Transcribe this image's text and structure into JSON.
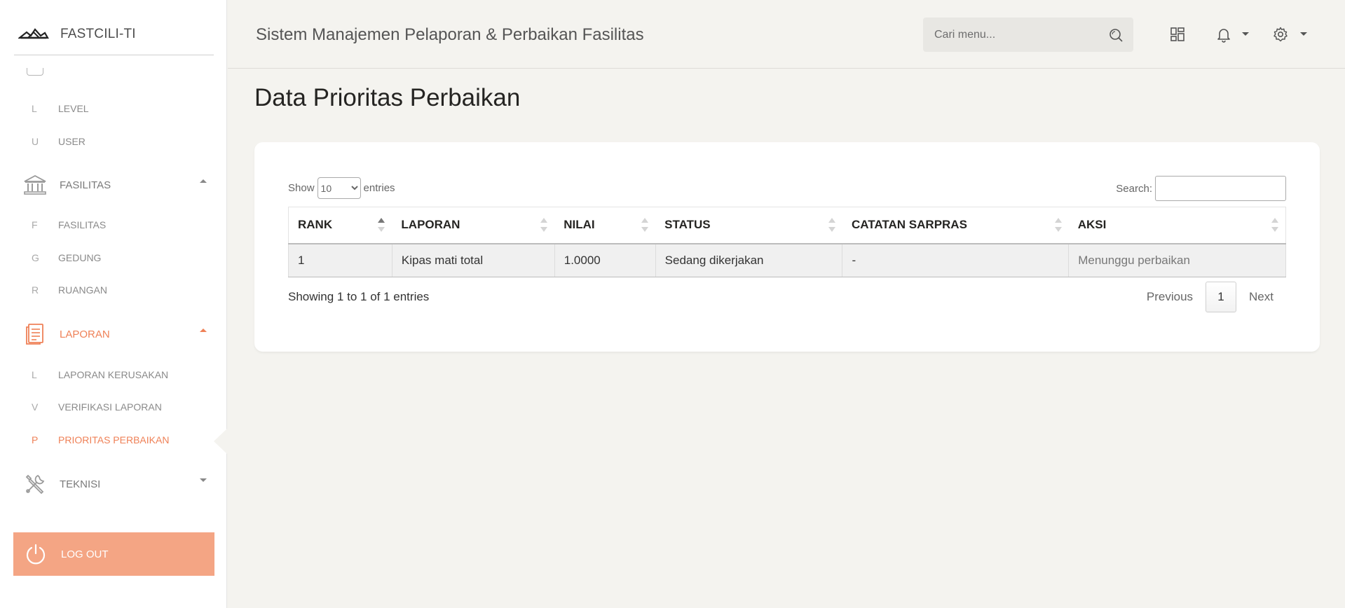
{
  "brand": {
    "name": "FASTCILI-TI"
  },
  "sidebar": {
    "items": [
      {
        "abbr": "L",
        "label": "LEVEL"
      },
      {
        "abbr": "U",
        "label": "USER"
      },
      {
        "label": "FASILITAS",
        "icon": "building-icon"
      },
      {
        "abbr": "F",
        "label": "FASILITAS"
      },
      {
        "abbr": "G",
        "label": "GEDUNG"
      },
      {
        "abbr": "R",
        "label": "RUANGAN"
      },
      {
        "label": "LAPORAN",
        "icon": "document-icon"
      },
      {
        "abbr": "L",
        "label": "LAPORAN KERUSAKAN"
      },
      {
        "abbr": "V",
        "label": "VERIFIKASI LAPORAN"
      },
      {
        "abbr": "P",
        "label": "PRIORITAS PERBAIKAN"
      },
      {
        "label": "TEKNISI",
        "icon": "tools-icon"
      }
    ],
    "logout_label": "LOG OUT",
    "accent_color": "#ef8157"
  },
  "header": {
    "title": "Sistem Manajemen Pelaporan & Perbaikan Fasilitas",
    "search_placeholder": "Cari menu..."
  },
  "main": {
    "title": "Data Prioritas Perbaikan",
    "table": {
      "show_label": "Show",
      "entries_label": "entries",
      "page_length": "10",
      "search_label": "Search:",
      "columns": [
        "RANK",
        "LAPORAN",
        "NILAI",
        "STATUS",
        "CATATAN SARPRAS",
        "AKSI"
      ],
      "rows": [
        [
          "1",
          "Kipas mati total",
          "1.0000",
          "Sedang dikerjakan",
          "-",
          "Menunggu perbaikan"
        ]
      ],
      "info": "Showing 1 to 1 of 1 entries",
      "pagination": {
        "previous": "Previous",
        "current": "1",
        "next": "Next"
      }
    }
  }
}
